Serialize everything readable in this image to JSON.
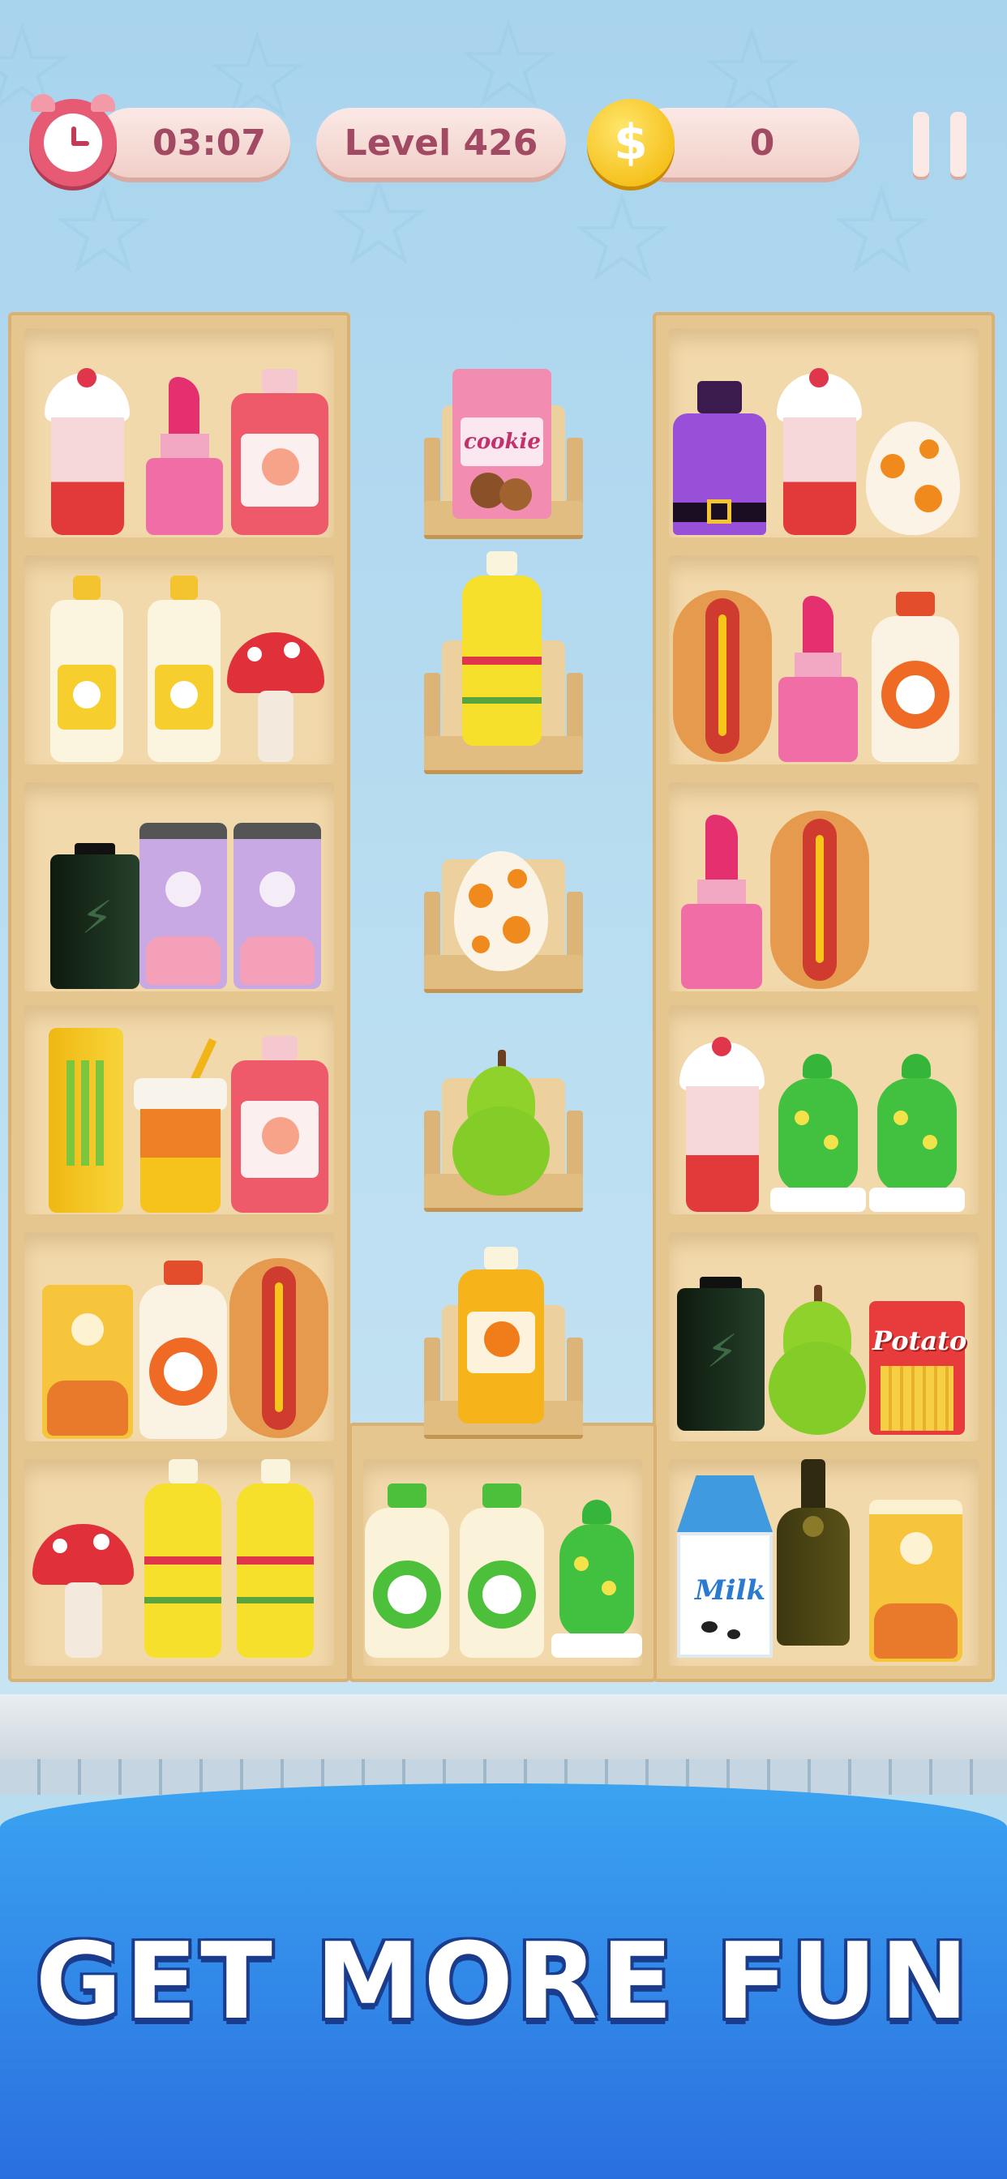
{
  "hud": {
    "timer": "03:07",
    "level": "Level 426",
    "coin_symbol": "$",
    "coins": "0"
  },
  "labels": {
    "cookie": "cookie",
    "milk": "Milk",
    "potato": "Potato"
  },
  "banner": {
    "text": "GET MORE FUN"
  },
  "colors": {
    "background": "#a9d4ee",
    "shelf": "#f2d9ab",
    "hud_text": "#a24a63",
    "banner": "#2a6fe0"
  }
}
